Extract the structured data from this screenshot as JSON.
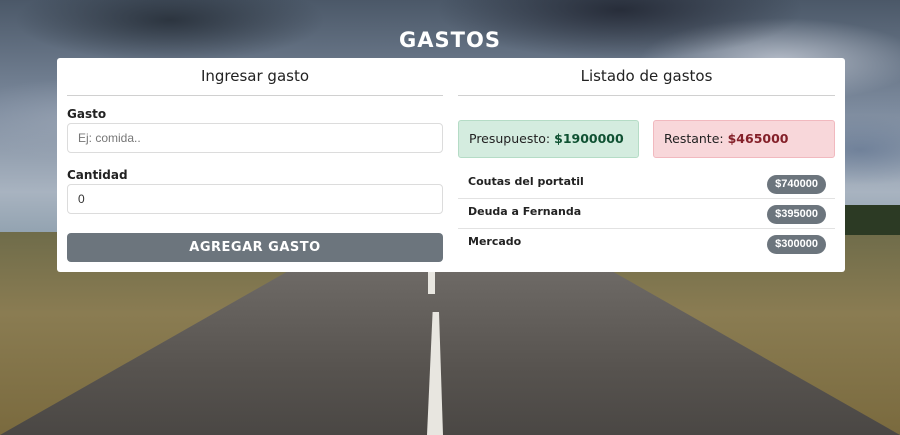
{
  "app": {
    "title": "GASTOS"
  },
  "form": {
    "heading": "Ingresar gasto",
    "expense_label": "Gasto",
    "expense_placeholder": "Ej: comida..",
    "expense_value": "",
    "amount_label": "Cantidad",
    "amount_value": "0",
    "submit_label": "AGREGAR GASTO"
  },
  "listing": {
    "heading": "Listado de gastos",
    "budget_label": "Presupuesto:",
    "budget_value": "$1900000",
    "remaining_label": "Restante:",
    "remaining_value": "$465000",
    "items": [
      {
        "name": "Coutas del portatil",
        "amount": "$740000"
      },
      {
        "name": "Deuda a Fernanda",
        "amount": "$395000"
      },
      {
        "name": "Mercado",
        "amount": "$300000"
      }
    ]
  },
  "colors": {
    "budget_bg": "#d4ecdf",
    "remaining_bg": "#f8d7da",
    "button_bg": "#6c757d"
  }
}
